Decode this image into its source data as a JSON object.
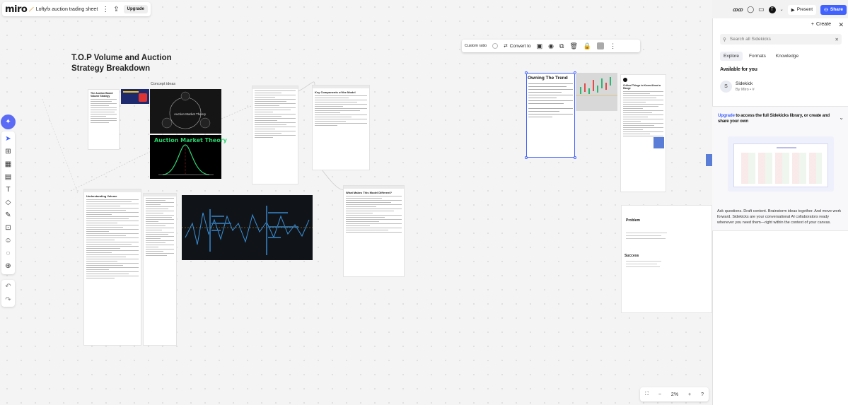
{
  "app": {
    "logo": "miro",
    "board_name": "Loftyfx auction trading sheet",
    "upgrade": "Upgrade"
  },
  "top_right": {
    "present": "Present",
    "share": "Share",
    "avatar_letter": "T"
  },
  "context_toolbar": {
    "ratio": "Custom ratio",
    "convert": "Convert to"
  },
  "board": {
    "title_line1": "T.O.P Volume and Auction",
    "title_line2": "Strategy Breakdown",
    "concept_label": "Concept ideas",
    "amt_diagram_label": "Auction Market Theory",
    "amt_title": "Auction Market Theory",
    "selected_card_title": "Owning The Trend",
    "doc_titles": {
      "doc1": "The Auction Based Volume Strategy",
      "doc2": "Understanding Volume",
      "doc3": "Key Components of the Model",
      "doc4": "What Makes This Model Different?",
      "doc5": "Critical Things to Know About a Range"
    },
    "problem_title": "Problem",
    "success_title": "Success"
  },
  "sidebar": {
    "create": "Create",
    "search_placeholder": "Search all Sidekicks",
    "tabs": [
      "Explore",
      "Formats",
      "Knowledge"
    ],
    "available_heading": "Available for you",
    "sidekick_name": "Sidekick",
    "sidekick_by": "By Miro",
    "sidekick_avatar": "S",
    "upgrade_link": "Upgrade",
    "upgrade_text": " to access the full Sidekicks library, or create and share your own",
    "description": "Ask questions. Draft content. Brainstorm ideas together. And move work forward. Sidekicks are your conversational AI collaborators ready whenever you need them—right within the context of your canvas."
  },
  "zoom": {
    "level": "2%"
  }
}
